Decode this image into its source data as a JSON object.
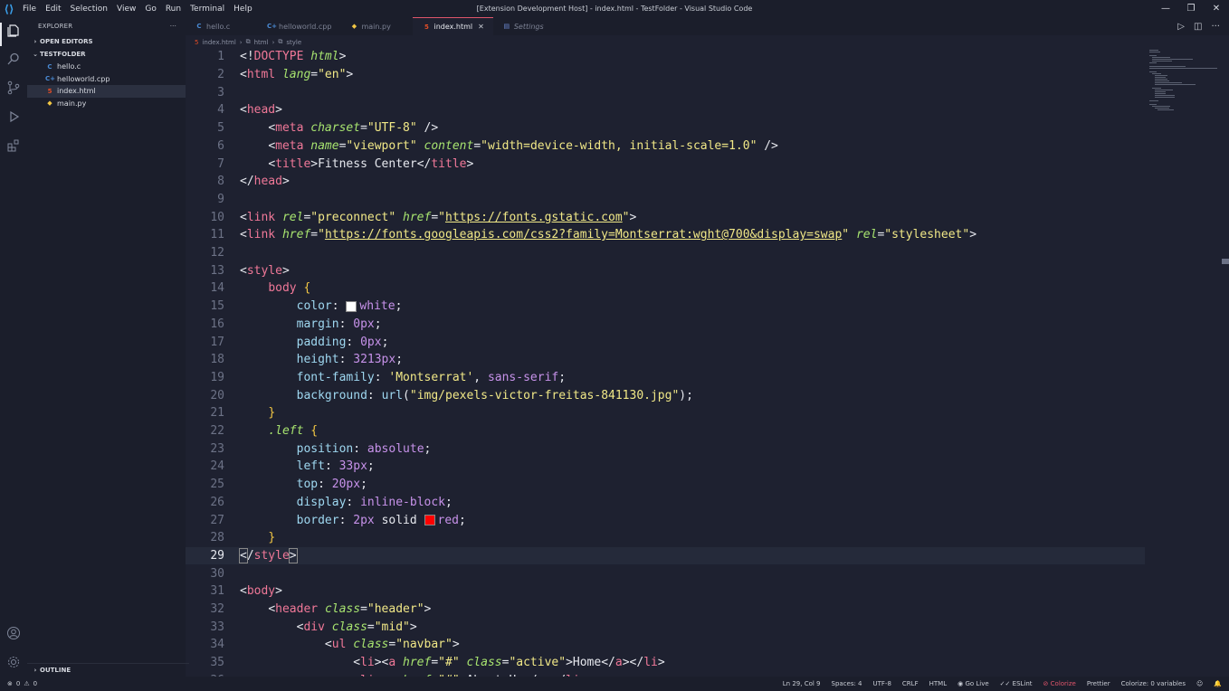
{
  "titlebar": {
    "menu": [
      "File",
      "Edit",
      "Selection",
      "View",
      "Go",
      "Run",
      "Terminal",
      "Help"
    ],
    "title": "[Extension Development Host] - index.html - TestFolder - Visual Studio Code"
  },
  "sidebar": {
    "header": "EXPLORER",
    "open_editors": "OPEN EDITORS",
    "folder": "TESTFOLDER",
    "files": [
      "hello.c",
      "helloworld.cpp",
      "index.html",
      "main.py"
    ],
    "outline": "OUTLINE"
  },
  "tabs": [
    {
      "label": "hello.c"
    },
    {
      "label": "helloworld.cpp"
    },
    {
      "label": "main.py"
    },
    {
      "label": "index.html"
    },
    {
      "label": "Settings"
    }
  ],
  "breadcrumb": [
    "index.html",
    "html",
    "style"
  ],
  "editor": {
    "current_line": 29
  },
  "statusbar": {
    "problems": "0",
    "warnings": "0",
    "position": "Ln 29, Col 9",
    "spaces": "Spaces: 4",
    "encoding": "UTF-8",
    "eol": "CRLF",
    "language": "HTML",
    "golive": "Go Live",
    "eslint": "ESLint",
    "colorize": "Colorize",
    "prettier": "Prettier",
    "colorize_vars": "Colorize: 0 variables"
  },
  "colors": {
    "accent": "#e0556b",
    "background": "#1e2130"
  }
}
